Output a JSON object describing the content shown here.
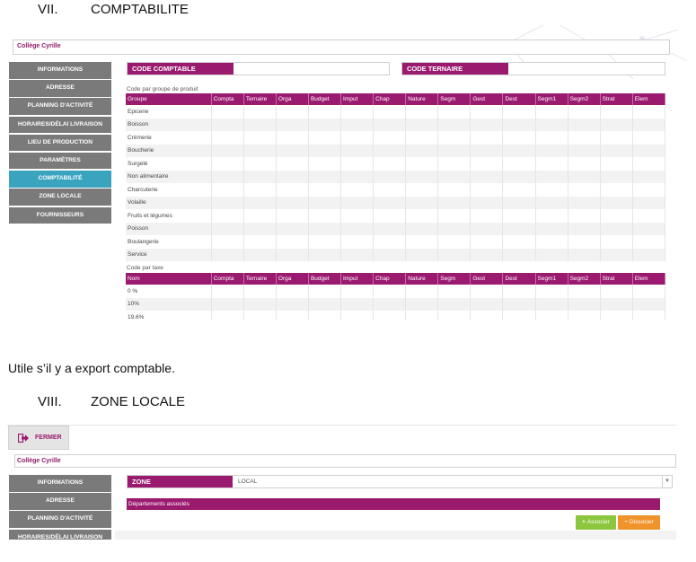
{
  "doc": {
    "heading7": {
      "num": "VII.",
      "text": "COMPTABILITE"
    },
    "para": "Utile s’il y a export comptable.",
    "heading8": {
      "num": "VIII.",
      "text": "ZONE LOCALE"
    }
  },
  "shot1": {
    "college": "Collège Cyrille",
    "sidebar": [
      "INFORMATIONS",
      "ADRESSE",
      "PLANNING D'ACTIVITÉ",
      "HORAIRES/DÉLAI LIVRAISON",
      "LIEU DE PRODUCTION",
      "PARAMÈTRES",
      "COMPTABILITÉ",
      "ZONE LOCALE",
      "FOURNISSEURS"
    ],
    "active_index": 6,
    "code_comptable": "CODE COMPTABLE",
    "code_ternaire": "CODE TERNAIRE",
    "group_label": "Code par groupe de produit",
    "group_table": {
      "headers": [
        "Groupe",
        "Compta",
        "Ternaire",
        "Orga",
        "Budget",
        "Imput",
        "Chap",
        "Nature",
        "Segm",
        "Gest",
        "Dest",
        "Segm1",
        "Segm2",
        "Strat",
        "Elem"
      ],
      "rows": [
        "Epicerie",
        "Boisson",
        "Crémerie",
        "Boucherie",
        "Surgelé",
        "Non alimentaire",
        "Charcuterie",
        "Volaille",
        "Fruits et légumes",
        "Poisson",
        "Boulangerie",
        "Service"
      ]
    },
    "tax_label": "Code par taxe",
    "tax_table": {
      "headers": [
        "Nom",
        "Compta",
        "Ternaire",
        "Orga",
        "Budget",
        "Imput",
        "Chap",
        "Nature",
        "Segm",
        "Gest",
        "Dest",
        "Segm1",
        "Segm2",
        "Strat",
        "Elem"
      ],
      "rows": [
        "0 %",
        "10%",
        "19.6%"
      ]
    }
  },
  "shot2": {
    "fermer": "FERMER",
    "college": "Collège Cyrille",
    "sidebar": [
      "INFORMATIONS",
      "ADRESSE",
      "PLANNING D'ACTIVITÉ",
      "HORAIRES/DÉLAI LIVRAISON"
    ],
    "zone_label": "ZONE",
    "zone_value": "LOCAL",
    "departements": "Départements associés",
    "associer": "Associer",
    "dissocier": "Dissocier"
  },
  "colors": {
    "magenta": "#9a1a6f",
    "sidebar_gray": "#7a7a7a",
    "sidebar_active": "#3aa4bf",
    "green": "#8cc63f",
    "orange": "#f0932b"
  }
}
